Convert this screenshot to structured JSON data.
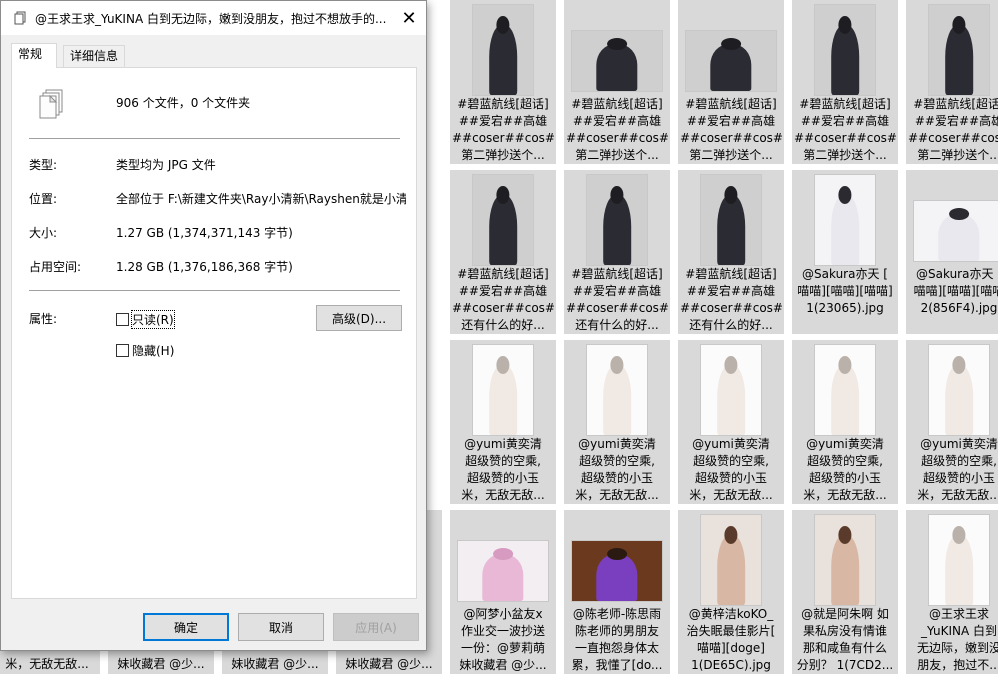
{
  "dialog": {
    "title": "@王求王求_YuKINA  白到无边际，嫩到没朋友，抱过不想放手的...",
    "tabs": [
      "常规",
      "详细信息"
    ],
    "summary": "906 个文件，0 个文件夹",
    "fields": {
      "type_label": "类型:",
      "type_value": "类型均为 JPG 文件",
      "location_label": "位置:",
      "location_value": "全部位于 F:\\新建文件夹\\Ray小清新\\Rayshen就是小清",
      "size_label": "大小:",
      "size_value": "1.27 GB (1,374,371,143 字节)",
      "disk_label": "占用空间:",
      "disk_value": "1.28 GB (1,376,186,368 字节)",
      "attr_label": "属性:"
    },
    "readonly_label": "只读(R)",
    "hidden_label": "隐藏(H)",
    "advanced_label": "高级(D)...",
    "ok_label": "确定",
    "cancel_label": "取消",
    "apply_label": "应用(A)",
    "close_glyph": "✕"
  },
  "grid": {
    "rows": [
      [
        {
          "lines": [
            "#碧蓝航线[超话]",
            "##爱宕##高雄",
            "##coser##cos#",
            "第二弹抄送个..."
          ],
          "orient": "port",
          "tone": "dark"
        },
        {
          "lines": [
            "#碧蓝航线[超话]",
            "##爱宕##高雄",
            "##coser##cos#",
            "第二弹抄送个..."
          ],
          "orient": "land",
          "tone": "dark"
        },
        {
          "lines": [
            "#碧蓝航线[超话]",
            "##爱宕##高雄",
            "##coser##cos#",
            "第二弹抄送个..."
          ],
          "orient": "land",
          "tone": "dark"
        },
        {
          "lines": [
            "#碧蓝航线[超话]",
            "##爱宕##高雄",
            "##coser##cos#",
            "第二弹抄送个..."
          ],
          "orient": "port",
          "tone": "dark"
        },
        {
          "lines": [
            "#碧蓝航线[超话]",
            "##爱宕##高雄",
            "##coser##cos#",
            "第二弹抄送个..."
          ],
          "orient": "port",
          "tone": "dark"
        }
      ],
      [
        {
          "lines": [
            "#碧蓝航线[超话]",
            "##爱宕##高雄",
            "##coser##cos#",
            "还有什么的好..."
          ],
          "orient": "port",
          "tone": "dark"
        },
        {
          "lines": [
            "#碧蓝航线[超话]",
            "##爱宕##高雄",
            "##coser##cos#",
            "还有什么的好..."
          ],
          "orient": "port",
          "tone": "dark"
        },
        {
          "lines": [
            "#碧蓝航线[超话]",
            "##爱宕##高雄",
            "##coser##cos#",
            "还有什么的好..."
          ],
          "orient": "port",
          "tone": "dark"
        },
        {
          "lines": [
            "@Sakura亦天 [",
            "喵喵][喵喵][喵喵]",
            "1(23065).jpg"
          ],
          "orient": "port",
          "tone": "light"
        },
        {
          "lines": [
            "@Sakura亦天 [",
            "喵喵][喵喵][喵喵",
            "2(856F4).jpg"
          ],
          "orient": "land",
          "tone": "light"
        }
      ],
      [
        {
          "lines": [
            "@yumi黄奕清",
            "超级赞的空乘,",
            "超级赞的小玉",
            "米，无敌无敌..."
          ],
          "orient": "port",
          "tone": "white"
        },
        {
          "lines": [
            "@yumi黄奕清",
            "超级赞的空乘,",
            "超级赞的小玉",
            "米，无敌无敌..."
          ],
          "orient": "port",
          "tone": "white"
        },
        {
          "lines": [
            "@yumi黄奕清",
            "超级赞的空乘,",
            "超级赞的小玉",
            "米，无敌无敌..."
          ],
          "orient": "port",
          "tone": "white"
        },
        {
          "lines": [
            "@yumi黄奕清",
            "超级赞的空乘,",
            "超级赞的小玉",
            "米，无敌无敌..."
          ],
          "orient": "port",
          "tone": "white"
        },
        {
          "lines": [
            "@yumi黄奕清",
            "超级赞的空乘,",
            "超级赞的小玉",
            "米，无敌无敌..."
          ],
          "orient": "port",
          "tone": "white"
        }
      ],
      [
        {
          "lines": [
            "@阿梦小盆友x",
            "作业交一波抄送",
            "一份：@萝莉萌",
            "妹收藏君 @少..."
          ],
          "orient": "land",
          "tone": "pink"
        },
        {
          "lines": [
            "@陈老师-陈思雨",
            "陈老师的男朋友",
            "一直抱怨身体太",
            "累，我懂了[do..."
          ],
          "orient": "land",
          "tone": "purple"
        },
        {
          "lines": [
            "@黄梓洁koKO_",
            "治失眠最佳影片[",
            "喵喵][doge]",
            "1(DE65C).jpg"
          ],
          "orient": "port",
          "tone": "skin"
        },
        {
          "lines": [
            "@就是阿朱啊 如",
            "果私房没有情谁",
            "那和咸鱼有什么",
            "分别？ 1(7CD2..."
          ],
          "orient": "port",
          "tone": "skin"
        },
        {
          "lines": [
            "@王求王求",
            "_YuKINA 白到",
            "无边际，嫩到没",
            "朋友，抱过不..."
          ],
          "orient": "port",
          "tone": "white"
        }
      ]
    ],
    "left_partial_rows": [
      [
        "",
        "",
        "",
        ""
      ],
      [
        "",
        "",
        "",
        ""
      ],
      [
        "",
        "",
        "",
        ""
      ],
      [
        "超级赞的小玉",
        "米，无敌无敌...",
        "妹收藏君 @少...",
        "妹收藏君 @少..."
      ]
    ],
    "bottom_left_lines": [
      [
        "米，无敌无敌..."
      ],
      [
        "妹收藏君 @少..."
      ],
      [
        "妹收藏君 @少..."
      ],
      [
        "妹收藏君 @少..."
      ]
    ]
  },
  "colors": {
    "accent": "#0078d7",
    "tile_bg": "#d9d9d9"
  }
}
